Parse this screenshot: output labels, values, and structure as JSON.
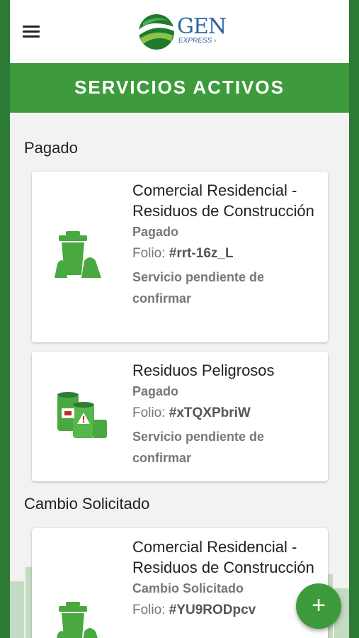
{
  "header": {
    "menu_icon": "hamburger-menu-icon",
    "logo": {
      "word": "GEN",
      "sub": "EXPRESS"
    },
    "title": "SERVICIOS ACTIVOS"
  },
  "sections": [
    {
      "label": "Pagado"
    },
    {
      "label": "Cambio Solicitado"
    }
  ],
  "cards": [
    {
      "title": "Comercial Residencial - Residuos de Construcción",
      "status": "Pagado",
      "folio_label": "Folio: ",
      "folio_value": "#rrt-16z_L",
      "note": "Servicio pendiente de confirmar",
      "icon": "trash-bin-icon"
    },
    {
      "title": "Residuos Peligrosos",
      "status": "Pagado",
      "folio_label": "Folio: ",
      "folio_value": "#xTQXPbriW",
      "note": "Servicio pendiente de confirmar",
      "icon": "hazardous-barrels-icon"
    },
    {
      "title": "Comercial Residencial - Residuos de Construcción",
      "status": "Cambio Solicitado",
      "folio_label": "Folio: ",
      "folio_value": "#YU9RODpcv",
      "icon": "trash-bin-icon"
    }
  ],
  "fab": {
    "label": "+",
    "icon": "plus-icon"
  },
  "colors": {
    "primary": "#3e9b3c",
    "brand_blue": "#2d63a3"
  }
}
